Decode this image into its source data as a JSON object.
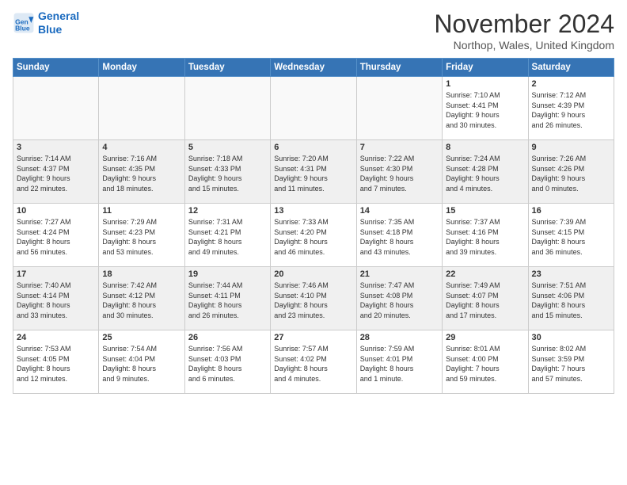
{
  "logo": {
    "line1": "General",
    "line2": "Blue"
  },
  "title": "November 2024",
  "location": "Northop, Wales, United Kingdom",
  "weekdays": [
    "Sunday",
    "Monday",
    "Tuesday",
    "Wednesday",
    "Thursday",
    "Friday",
    "Saturday"
  ],
  "weeks": [
    [
      {
        "day": "",
        "info": ""
      },
      {
        "day": "",
        "info": ""
      },
      {
        "day": "",
        "info": ""
      },
      {
        "day": "",
        "info": ""
      },
      {
        "day": "",
        "info": ""
      },
      {
        "day": "1",
        "info": "Sunrise: 7:10 AM\nSunset: 4:41 PM\nDaylight: 9 hours\nand 30 minutes."
      },
      {
        "day": "2",
        "info": "Sunrise: 7:12 AM\nSunset: 4:39 PM\nDaylight: 9 hours\nand 26 minutes."
      }
    ],
    [
      {
        "day": "3",
        "info": "Sunrise: 7:14 AM\nSunset: 4:37 PM\nDaylight: 9 hours\nand 22 minutes."
      },
      {
        "day": "4",
        "info": "Sunrise: 7:16 AM\nSunset: 4:35 PM\nDaylight: 9 hours\nand 18 minutes."
      },
      {
        "day": "5",
        "info": "Sunrise: 7:18 AM\nSunset: 4:33 PM\nDaylight: 9 hours\nand 15 minutes."
      },
      {
        "day": "6",
        "info": "Sunrise: 7:20 AM\nSunset: 4:31 PM\nDaylight: 9 hours\nand 11 minutes."
      },
      {
        "day": "7",
        "info": "Sunrise: 7:22 AM\nSunset: 4:30 PM\nDaylight: 9 hours\nand 7 minutes."
      },
      {
        "day": "8",
        "info": "Sunrise: 7:24 AM\nSunset: 4:28 PM\nDaylight: 9 hours\nand 4 minutes."
      },
      {
        "day": "9",
        "info": "Sunrise: 7:26 AM\nSunset: 4:26 PM\nDaylight: 9 hours\nand 0 minutes."
      }
    ],
    [
      {
        "day": "10",
        "info": "Sunrise: 7:27 AM\nSunset: 4:24 PM\nDaylight: 8 hours\nand 56 minutes."
      },
      {
        "day": "11",
        "info": "Sunrise: 7:29 AM\nSunset: 4:23 PM\nDaylight: 8 hours\nand 53 minutes."
      },
      {
        "day": "12",
        "info": "Sunrise: 7:31 AM\nSunset: 4:21 PM\nDaylight: 8 hours\nand 49 minutes."
      },
      {
        "day": "13",
        "info": "Sunrise: 7:33 AM\nSunset: 4:20 PM\nDaylight: 8 hours\nand 46 minutes."
      },
      {
        "day": "14",
        "info": "Sunrise: 7:35 AM\nSunset: 4:18 PM\nDaylight: 8 hours\nand 43 minutes."
      },
      {
        "day": "15",
        "info": "Sunrise: 7:37 AM\nSunset: 4:16 PM\nDaylight: 8 hours\nand 39 minutes."
      },
      {
        "day": "16",
        "info": "Sunrise: 7:39 AM\nSunset: 4:15 PM\nDaylight: 8 hours\nand 36 minutes."
      }
    ],
    [
      {
        "day": "17",
        "info": "Sunrise: 7:40 AM\nSunset: 4:14 PM\nDaylight: 8 hours\nand 33 minutes."
      },
      {
        "day": "18",
        "info": "Sunrise: 7:42 AM\nSunset: 4:12 PM\nDaylight: 8 hours\nand 30 minutes."
      },
      {
        "day": "19",
        "info": "Sunrise: 7:44 AM\nSunset: 4:11 PM\nDaylight: 8 hours\nand 26 minutes."
      },
      {
        "day": "20",
        "info": "Sunrise: 7:46 AM\nSunset: 4:10 PM\nDaylight: 8 hours\nand 23 minutes."
      },
      {
        "day": "21",
        "info": "Sunrise: 7:47 AM\nSunset: 4:08 PM\nDaylight: 8 hours\nand 20 minutes."
      },
      {
        "day": "22",
        "info": "Sunrise: 7:49 AM\nSunset: 4:07 PM\nDaylight: 8 hours\nand 17 minutes."
      },
      {
        "day": "23",
        "info": "Sunrise: 7:51 AM\nSunset: 4:06 PM\nDaylight: 8 hours\nand 15 minutes."
      }
    ],
    [
      {
        "day": "24",
        "info": "Sunrise: 7:53 AM\nSunset: 4:05 PM\nDaylight: 8 hours\nand 12 minutes."
      },
      {
        "day": "25",
        "info": "Sunrise: 7:54 AM\nSunset: 4:04 PM\nDaylight: 8 hours\nand 9 minutes."
      },
      {
        "day": "26",
        "info": "Sunrise: 7:56 AM\nSunset: 4:03 PM\nDaylight: 8 hours\nand 6 minutes."
      },
      {
        "day": "27",
        "info": "Sunrise: 7:57 AM\nSunset: 4:02 PM\nDaylight: 8 hours\nand 4 minutes."
      },
      {
        "day": "28",
        "info": "Sunrise: 7:59 AM\nSunset: 4:01 PM\nDaylight: 8 hours\nand 1 minute."
      },
      {
        "day": "29",
        "info": "Sunrise: 8:01 AM\nSunset: 4:00 PM\nDaylight: 7 hours\nand 59 minutes."
      },
      {
        "day": "30",
        "info": "Sunrise: 8:02 AM\nSunset: 3:59 PM\nDaylight: 7 hours\nand 57 minutes."
      }
    ]
  ]
}
